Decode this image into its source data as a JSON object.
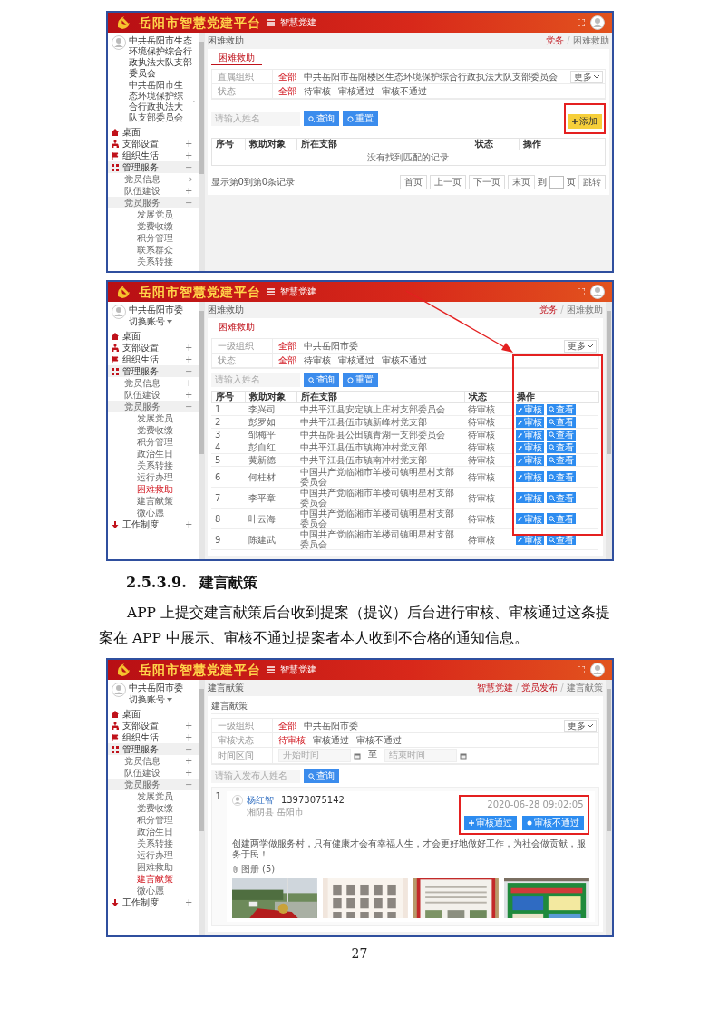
{
  "screenshots": [
    {
      "app_title": "岳阳市智慧党建平台",
      "module": "智慧党建",
      "user": {
        "name": "中共岳阳市生态环境保护综合行政执法大队支部委员会",
        "account": "中共岳阳市生态环境保护综合行政执法大队支部委员会"
      },
      "menu": [
        {
          "label": "桌面",
          "selected": false
        },
        {
          "label": "支部设置",
          "toggle": "+",
          "selected": false
        },
        {
          "label": "组织生活",
          "toggle": "+",
          "selected": false
        },
        {
          "label": "管理服务",
          "toggle": "−",
          "selected": false,
          "children": [
            {
              "label": "党员信息",
              "toggle": "›",
              "selected": false
            },
            {
              "label": "队伍建设",
              "toggle": "+",
              "selected": false
            },
            {
              "label": "党员服务",
              "toggle": "−",
              "selected": false,
              "children": [
                {
                  "label": "发展党员",
                  "selected": false
                },
                {
                  "label": "党费收缴",
                  "selected": false
                },
                {
                  "label": "积分管理",
                  "selected": false
                },
                {
                  "label": "联系群众",
                  "selected": false
                },
                {
                  "label": "关系转接",
                  "selected": false
                }
              ]
            }
          ]
        }
      ],
      "page_title": "困难救助",
      "crumbs": [
        "党务",
        "困难救助"
      ],
      "crumb_separator": "/",
      "tab": "困难救助",
      "filters": [
        {
          "kind": "options",
          "label": "直属组织",
          "options": [
            {
              "label": "全部",
              "selected": true
            },
            {
              "label": "中共岳阳市岳阳楼区生态环境保护综合行政执法大队支部委员会",
              "selected": false
            }
          ]
        },
        {
          "kind": "options",
          "label": "状态",
          "options": [
            {
              "label": "全部",
              "selected": true
            },
            {
              "label": "待审核",
              "selected": false
            },
            {
              "label": "审核通过",
              "selected": false
            },
            {
              "label": "审核不通过",
              "selected": false
            }
          ]
        }
      ],
      "more": "更多",
      "search": {
        "placeholder": "请输入姓名"
      },
      "buttons": [
        "查询",
        "重置"
      ],
      "add_button": {
        "label": "添加",
        "highlighted": true
      },
      "table": {
        "columns": [
          "序号",
          "救助对象",
          "所在支部",
          "状态",
          "操作"
        ],
        "empty_text": "没有找到匹配的记录"
      },
      "pager": {
        "info": "显示第0到第0条记录",
        "buttons": [
          "首页",
          "上一页",
          "下一页",
          "末页"
        ],
        "jump_prefix": "到",
        "jump_suffix": "页",
        "jump_button": "跳转"
      }
    },
    {
      "app_title": "岳阳市智慧党建平台",
      "module": "智慧党建",
      "user": {
        "name": "中共岳阳市委",
        "account": "切换账号"
      },
      "menu": [
        {
          "label": "桌面",
          "selected": false
        },
        {
          "label": "支部设置",
          "toggle": "+",
          "selected": false
        },
        {
          "label": "组织生活",
          "toggle": "+",
          "selected": false
        },
        {
          "label": "管理服务",
          "toggle": "−",
          "selected": false,
          "children": [
            {
              "label": "党员信息",
              "toggle": "+",
              "selected": false
            },
            {
              "label": "队伍建设",
              "toggle": "+",
              "selected": false
            },
            {
              "label": "党员服务",
              "toggle": "−",
              "selected": false,
              "children": [
                {
                  "label": "发展党员",
                  "selected": false
                },
                {
                  "label": "党费收缴",
                  "selected": false
                },
                {
                  "label": "积分管理",
                  "selected": false
                },
                {
                  "label": "政治生日",
                  "selected": false
                },
                {
                  "label": "关系转接",
                  "selected": false
                },
                {
                  "label": "运行办理",
                  "selected": false
                },
                {
                  "label": "困难救助",
                  "selected": true
                },
                {
                  "label": "建言献策",
                  "selected": false
                },
                {
                  "label": "微心愿",
                  "selected": false
                }
              ]
            }
          ]
        },
        {
          "label": "工作制度",
          "toggle": "+",
          "selected": false
        }
      ],
      "page_title": "困难救助",
      "crumbs": [
        "党务",
        "困难救助"
      ],
      "crumb_separator": "/",
      "tab": "困难救助",
      "filters": [
        {
          "kind": "options",
          "label": "一级组织",
          "options": [
            {
              "label": "全部",
              "selected": true
            },
            {
              "label": "中共岳阳市委",
              "selected": false
            }
          ]
        },
        {
          "kind": "options",
          "label": "状态",
          "options": [
            {
              "label": "全部",
              "selected": true
            },
            {
              "label": "待审核",
              "selected": false
            },
            {
              "label": "审核通过",
              "selected": false
            },
            {
              "label": "审核不通过",
              "selected": false
            }
          ]
        }
      ],
      "more": "更多",
      "search": {
        "placeholder": "请输入姓名"
      },
      "buttons": [
        "查询",
        "重置"
      ],
      "table": {
        "columns": [
          "序号",
          "救助对象",
          "所在支部",
          "状态",
          "操作"
        ],
        "actions_highlighted": true,
        "rows": [
          {
            "cells": [
              "1",
              "李兴司",
              "中共平江县安定镇上庄村支部委员会",
              "待审核"
            ],
            "actions": [
              "审核",
              "查看"
            ]
          },
          {
            "cells": [
              "2",
              "彭罗如",
              "中共平江县伍市镇新峰村党支部",
              "待审核"
            ],
            "actions": [
              "审核",
              "查看"
            ]
          },
          {
            "cells": [
              "3",
              "邹梅平",
              "中共岳阳县公田镇青湖一支部委员会",
              "待审核"
            ],
            "actions": [
              "审核",
              "查看"
            ]
          },
          {
            "cells": [
              "4",
              "彭自红",
              "中共平江县伍市镇梅冲村党支部",
              "待审核"
            ],
            "actions": [
              "审核",
              "查看"
            ]
          },
          {
            "cells": [
              "5",
              "黄新德",
              "中共平江县伍市镇南冲村党支部",
              "待审核"
            ],
            "actions": [
              "审核",
              "查看"
            ]
          },
          {
            "cells": [
              "6",
              "何桂材",
              "中国共产党临湘市羊楼司镇明星村支部委员会",
              "待审核"
            ],
            "actions": [
              "审核",
              "查看"
            ]
          },
          {
            "cells": [
              "7",
              "李平章",
              "中国共产党临湘市羊楼司镇明星村支部委员会",
              "待审核"
            ],
            "actions": [
              "审核",
              "查看"
            ]
          },
          {
            "cells": [
              "8",
              "叶云海",
              "中国共产党临湘市羊楼司镇明星村支部委员会",
              "待审核"
            ],
            "actions": [
              "审核",
              "查看"
            ]
          },
          {
            "cells": [
              "9",
              "陈建武",
              "中国共产党临湘市羊楼司镇明星村支部委员会",
              "待审核"
            ],
            "actions": [
              "审核",
              "查看"
            ]
          }
        ]
      },
      "arrow": true,
      "content_scrollbar": true
    },
    {
      "app_title": "岳阳市智慧党建平台",
      "module": "智慧党建",
      "user": {
        "name": "中共岳阳市委",
        "account": "切换账号"
      },
      "menu": [
        {
          "label": "桌面",
          "selected": false
        },
        {
          "label": "支部设置",
          "toggle": "+",
          "selected": false
        },
        {
          "label": "组织生活",
          "toggle": "+",
          "selected": false
        },
        {
          "label": "管理服务",
          "toggle": "−",
          "selected": false,
          "children": [
            {
              "label": "党员信息",
              "toggle": "+",
              "selected": false
            },
            {
              "label": "队伍建设",
              "toggle": "+",
              "selected": false
            },
            {
              "label": "党员服务",
              "toggle": "−",
              "selected": false,
              "children": [
                {
                  "label": "发展党员",
                  "selected": false
                },
                {
                  "label": "党费收缴",
                  "selected": false
                },
                {
                  "label": "积分管理",
                  "selected": false
                },
                {
                  "label": "政治生日",
                  "selected": false
                },
                {
                  "label": "关系转接",
                  "selected": false
                },
                {
                  "label": "运行办理",
                  "selected": false
                },
                {
                  "label": "困难救助",
                  "selected": false
                },
                {
                  "label": "建言献策",
                  "selected": true
                },
                {
                  "label": "微心愿",
                  "selected": false
                }
              ]
            }
          ]
        },
        {
          "label": "工作制度",
          "toggle": "+",
          "selected": false
        }
      ],
      "page_title": "建言献策",
      "crumbs": [
        "智慧党建",
        "党员发布",
        "建言献策"
      ],
      "crumb_separator": "/",
      "panel_title": "建言献策",
      "filters": [
        {
          "kind": "options",
          "label": "一级组织",
          "options": [
            {
              "label": "全部",
              "selected": true
            },
            {
              "label": "中共岳阳市委",
              "selected": false
            }
          ]
        },
        {
          "kind": "options",
          "label": "审核状态",
          "options": [
            {
              "label": "待审核",
              "selected": true
            },
            {
              "label": "审核通过",
              "selected": false
            },
            {
              "label": "审核不通过",
              "selected": false
            }
          ]
        },
        {
          "kind": "date_range",
          "label": "时间区间",
          "start_placeholder": "开始时间",
          "separator": "至",
          "end_placeholder": "结束时间"
        }
      ],
      "more": "更多",
      "search": {
        "placeholder": "请输入发布人姓名"
      },
      "buttons": [
        "查询"
      ],
      "post": {
        "index": "1",
        "name": "杨红智",
        "phone": "13973075142",
        "place": "湘阴县 岳阳市",
        "date": "2020-06-28 09:02:05",
        "text": "创建两学做服务村，只有健康才会有幸福人生，才会更好地做好工作，为社会做贡献，服务于民！",
        "buttons": [
          "审核通过",
          "审核不通过"
        ],
        "highlighted": true,
        "album": "图册 (5)",
        "photos": [
          {
            "kind": "picture"
          },
          {
            "kind": "picture"
          },
          {
            "kind": "picture"
          },
          {
            "kind": "picture"
          }
        ]
      },
      "content_scrollbar": true
    }
  ],
  "section": {
    "number": "2.5.3.9.",
    "title": "建言献策"
  },
  "paragraph": "APP 上提交建言献策后台收到提案（提议）后台进行审核、审核通过这条提案在 APP 中展示、审核不通过提案者本人收到不合格的通知信息。",
  "page_number": "27"
}
